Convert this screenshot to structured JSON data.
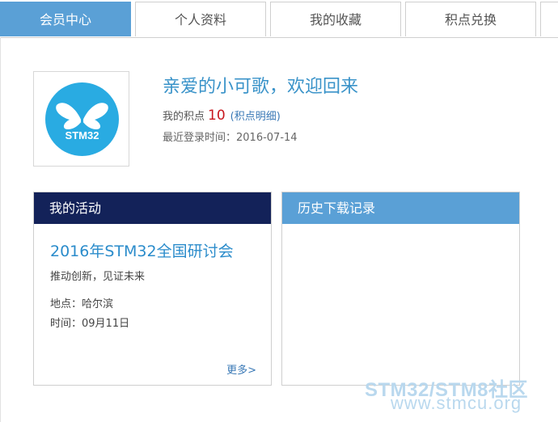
{
  "tabs": [
    {
      "label": "会员中心",
      "active": true
    },
    {
      "label": "个人资料",
      "active": false
    },
    {
      "label": "我的收藏",
      "active": false
    },
    {
      "label": "积点兑换",
      "active": false
    }
  ],
  "profile": {
    "avatar_icon": "butterfly-icon",
    "avatar_text": "STM32",
    "welcome": "亲爱的小可歌，欢迎回来",
    "points_label": "我的积点",
    "points_value": "10",
    "points_link": "(积点明细)",
    "last_login": "最近登录时间：2016-07-14"
  },
  "activity": {
    "header": "我的活动",
    "event_title": "2016年STM32全国研讨会",
    "slogan": "推动创新，见证未来",
    "place": "地点：哈尔滨",
    "time": "时间：09月11日",
    "more": "更多>"
  },
  "downloads": {
    "header": "历史下载记录"
  },
  "watermark": {
    "line1": "STM32/STM8社区",
    "line2": "www.stmcu.org"
  },
  "colors": {
    "tab_active": "#5aa0d6",
    "activity_header": "#132259",
    "download_header": "#5aa0d6",
    "points_value": "#c8161d",
    "avatar_bg": "#29abe2"
  }
}
